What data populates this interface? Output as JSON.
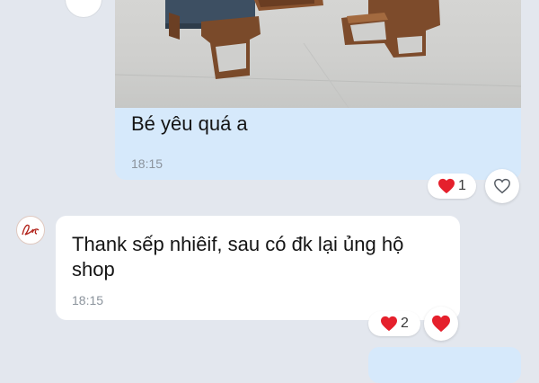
{
  "thread": {
    "outgoing": {
      "text": "Bé yêu quá a",
      "time": "18:15",
      "reaction_count": "1",
      "reaction_icon": "heart-icon",
      "react_button_icon": "heart-outline-icon"
    },
    "incoming": {
      "text_line1": "Thank sếp nhiêif, sau có đk lại ủng hộ",
      "text_line2": "shop",
      "time": "18:15",
      "reaction_count": "2",
      "reaction_icon": "heart-icon",
      "react_button_icon": "heart-icon"
    }
  },
  "colors": {
    "background": "#e3e7ee",
    "outgoing_bubble": "#d6e9fb",
    "incoming_bubble": "#ffffff",
    "heart": "#e5202c",
    "time_text": "#8b939c"
  }
}
